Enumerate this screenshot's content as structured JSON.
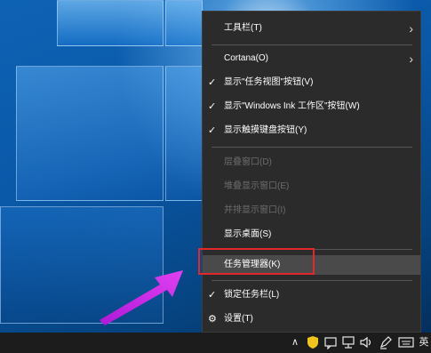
{
  "menu": {
    "items": [
      {
        "label": "工具栏(T)",
        "submenu": true
      },
      {
        "label": "Cortana(O)",
        "submenu": true
      },
      {
        "label": "显示\"任务视图\"按钮(V)",
        "checked": true
      },
      {
        "label": "显示\"Windows Ink 工作区\"按钮(W)",
        "checked": true
      },
      {
        "label": "显示触摸键盘按钮(Y)",
        "checked": true
      },
      {
        "label": "层叠窗口(D)",
        "disabled": true
      },
      {
        "label": "堆叠显示窗口(E)",
        "disabled": true
      },
      {
        "label": "并排显示窗口(I)",
        "disabled": true
      },
      {
        "label": "显示桌面(S)"
      },
      {
        "label": "任务管理器(K)",
        "highlighted": true
      },
      {
        "label": "锁定任务栏(L)",
        "checked": true
      },
      {
        "label": "设置(T)",
        "icon": "gear-icon"
      }
    ],
    "check_glyph": "✓",
    "chevron_glyph": "›",
    "gear_glyph": "⚙"
  },
  "taskbar": {
    "tray_chevron": "∧",
    "ime_label": "英"
  },
  "colors": {
    "menu_bg": "#2b2b2b",
    "highlight_border": "#e2282c",
    "arrow": "#d21ee0"
  }
}
